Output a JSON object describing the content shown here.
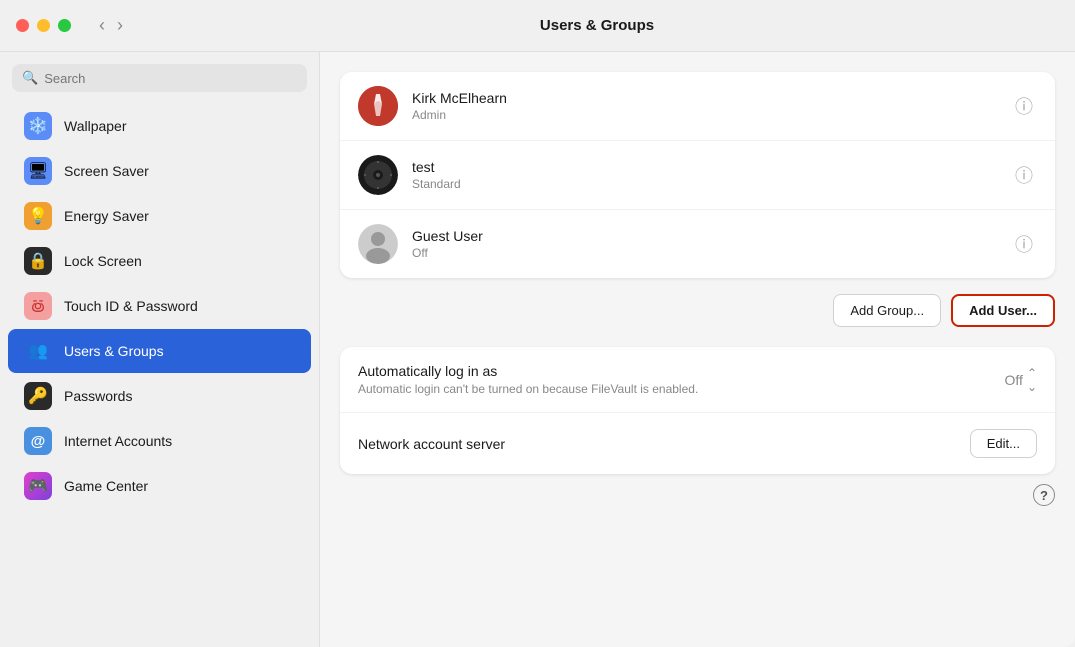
{
  "titlebar": {
    "title": "Users & Groups",
    "back_label": "‹",
    "forward_label": "›"
  },
  "sidebar": {
    "search_placeholder": "Search",
    "items": [
      {
        "id": "wallpaper",
        "label": "Wallpaper",
        "icon": "❄️",
        "icon_bg": "#5b8cf7",
        "active": false
      },
      {
        "id": "screen-saver",
        "label": "Screen Saver",
        "icon": "🖥",
        "icon_bg": "#5b8cf7",
        "active": false
      },
      {
        "id": "energy-saver",
        "label": "Energy Saver",
        "icon": "💡",
        "icon_bg": "#f0a030",
        "active": false
      },
      {
        "id": "lock-screen",
        "label": "Lock Screen",
        "icon": "🔒",
        "icon_bg": "#2a2a2a",
        "active": false
      },
      {
        "id": "touch-id",
        "label": "Touch ID & Password",
        "icon": "👆",
        "icon_bg": "#f5a0a0",
        "active": false
      },
      {
        "id": "users-groups",
        "label": "Users & Groups",
        "icon": "👥",
        "icon_bg": "#2962d9",
        "active": true
      },
      {
        "id": "passwords",
        "label": "Passwords",
        "icon": "🔑",
        "icon_bg": "#2a2a2a",
        "active": false
      },
      {
        "id": "internet-accounts",
        "label": "Internet Accounts",
        "icon": "@",
        "icon_bg": "#4a90e0",
        "active": false
      },
      {
        "id": "game-center",
        "label": "Game Center",
        "icon": "🎮",
        "icon_bg": "#e040cc",
        "active": false
      }
    ]
  },
  "main": {
    "title": "Users & Groups",
    "users": [
      {
        "id": "kirk",
        "name": "Kirk McElhearn",
        "role": "Admin",
        "avatar_type": "lightning"
      },
      {
        "id": "test",
        "name": "test",
        "role": "Standard",
        "avatar_type": "vinyl"
      },
      {
        "id": "guest",
        "name": "Guest User",
        "role": "Off",
        "avatar_type": "person"
      }
    ],
    "add_group_label": "Add Group...",
    "add_user_label": "Add User...",
    "settings": [
      {
        "id": "auto-login",
        "label": "Automatically log in as",
        "description": "Automatic login can't be turned on because FileVault is enabled.",
        "value": "Off",
        "control": "stepper"
      },
      {
        "id": "network-account",
        "label": "Network account server",
        "description": "",
        "value": "",
        "control": "edit",
        "edit_label": "Edit..."
      }
    ],
    "help_label": "?"
  }
}
